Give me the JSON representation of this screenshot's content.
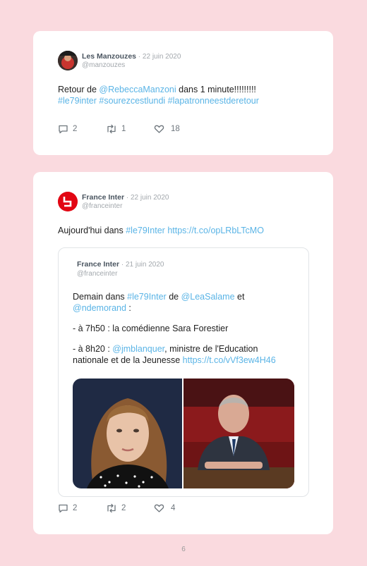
{
  "tweet1": {
    "author_name": "Les Manzouzes",
    "date": " · 22 juin 2020",
    "handle": "@manzouzes",
    "text_1": "Retour de ",
    "mention_1": "@RebeccaManzoni",
    "text_2": " dans 1 minute!!!!!!!!!",
    "hashtag_line": "#le79inter #sourezcestlundi #lapatronneestderetour",
    "replies": "2",
    "retweets": "1",
    "likes": "18"
  },
  "tweet2": {
    "author_name": "France Inter",
    "date": " · 22 juin 2020",
    "handle": "@franceinter",
    "text_1": "Aujourd'hui dans ",
    "hashtag": "#le79Inter",
    "link": "https://t.co/opLRbLTcMO",
    "replies": "2",
    "retweets": "2",
    "likes": "4",
    "quote": {
      "author_name": "France Inter",
      "date": " · 21 juin 2020",
      "handle": "@franceinter",
      "line1_a": "Demain dans ",
      "line1_hashtag": "#le79Inter",
      "line1_b": " de ",
      "line1_mention": "@LeaSalame",
      "line1_c": " et",
      "line2_mention": "@ndemorand",
      "line2_b": " :",
      "line3": "- à 7h50 : la comédienne Sara Forestier",
      "line4_a": "- à 8h20 : ",
      "line4_mention": "@jmblanquer",
      "line4_b": ", ministre de l'Education",
      "line5_a": "nationale et de la Jeunesse ",
      "line5_link": "https://t.co/vVf3ew4H46"
    }
  },
  "page_number": "6",
  "colors": {
    "background": "#fadadf",
    "link": "#5ab4e6",
    "france_inter_red": "#e20613"
  },
  "icons": [
    "reply-icon",
    "retweet-icon",
    "like-icon",
    "france-inter-logo"
  ]
}
